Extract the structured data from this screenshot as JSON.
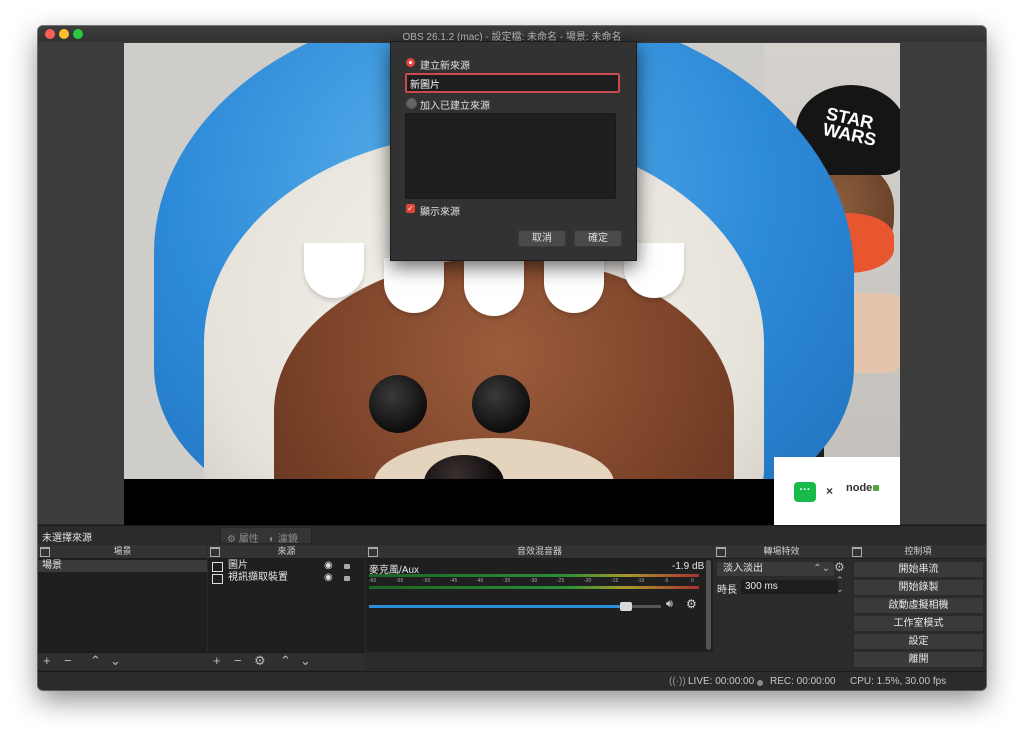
{
  "window": {
    "title": "OBS 26.1.2 (mac) - 設定檔: 未命名 - 場景: 未命名"
  },
  "dialog": {
    "create_new_label": "建立新來源",
    "name_value": "新圖片",
    "add_existing_label": "加入已建立來源",
    "make_visible_label": "顯示來源",
    "cancel_label": "取消",
    "ok_label": "確定"
  },
  "preview": {
    "cap_text": "STAR WARS",
    "logo_x": "×",
    "logo_node": "node"
  },
  "toolbar": {
    "no_source_label": "未選擇來源",
    "properties_label": "屬性",
    "filters_label": "濾鏡"
  },
  "scenes": {
    "title": "場景",
    "items": [
      "場景"
    ]
  },
  "sources": {
    "title": "來源",
    "items": [
      {
        "label": "圖片",
        "icon": "image-icon"
      },
      {
        "label": "視訊擷取裝置",
        "icon": "camera-icon"
      }
    ]
  },
  "mixer": {
    "title": "音效混音器",
    "channel_name": "麥克風/Aux",
    "db_value": "-1.9 dB",
    "ticks": [
      "-60",
      "-55",
      "-50",
      "-45",
      "-40",
      "-35",
      "-30",
      "-25",
      "-20",
      "-15",
      "-10",
      "-5",
      "0"
    ],
    "fader_level": 0.88
  },
  "transitions": {
    "title": "轉場特效",
    "selected": "淡入淡出",
    "duration_label": "時長",
    "duration_value": "300 ms"
  },
  "controls": {
    "title": "控制項",
    "buttons": [
      "開始串流",
      "開始錄製",
      "啟動虛擬相機",
      "工作室模式",
      "設定",
      "離開"
    ]
  },
  "status": {
    "live": "LIVE: 00:00:00",
    "rec": "REC: 00:00:00",
    "cpu": "CPU: 1.5%, 30.00 fps"
  },
  "colors": {
    "accent_red": "#e2443a",
    "fader_blue": "#2f8fd6",
    "panel_bg": "#2b2b2b"
  }
}
